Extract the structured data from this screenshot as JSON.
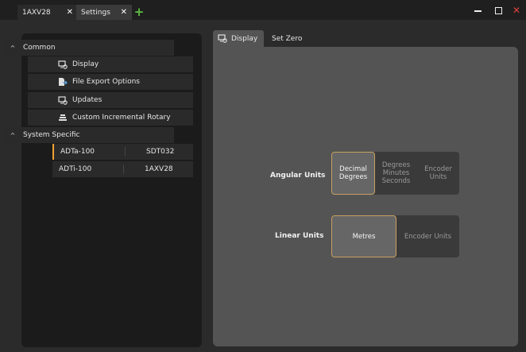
{
  "window": {
    "tabs": [
      {
        "label": "1AXV28",
        "close": "✕"
      },
      {
        "label": "Settings",
        "close": "✕"
      }
    ],
    "add_tab": "+",
    "controls": {
      "minimize": "—",
      "maximize": "",
      "close": "✕"
    },
    "accent": "#f0a030",
    "add_color": "#5ec043",
    "close_color": "#e04040"
  },
  "tree": {
    "common": {
      "label": "Common",
      "caret": "^"
    },
    "items": [
      {
        "label": "Display",
        "icon": "display-settings-icon"
      },
      {
        "label": "File Export Options",
        "icon": "file-export-icon"
      },
      {
        "label": "Updates",
        "icon": "updates-icon"
      },
      {
        "label": "Custom Incremental Rotary",
        "icon": "rotary-icon"
      }
    ],
    "system": {
      "label": "System Specific",
      "caret": "^"
    },
    "devices": [
      {
        "name": "ADTa-100",
        "value": "SDT032",
        "active": true
      },
      {
        "name": "ADTi-100",
        "value": "1AXV28",
        "active": false
      }
    ]
  },
  "panel": {
    "tabs": [
      {
        "label": "Display",
        "icon": "display-settings-icon"
      },
      {
        "label": "Set Zero"
      }
    ],
    "angular": {
      "label": "Angular Units",
      "options": [
        "Decimal\nDegrees",
        "Degrees\nMinutes\nSeconds",
        "Encoder\nUnits"
      ],
      "selected": "Decimal Degrees"
    },
    "linear": {
      "label": "Linear Units",
      "options": [
        "Metres",
        "Encoder Units"
      ],
      "selected": "Metres"
    }
  }
}
